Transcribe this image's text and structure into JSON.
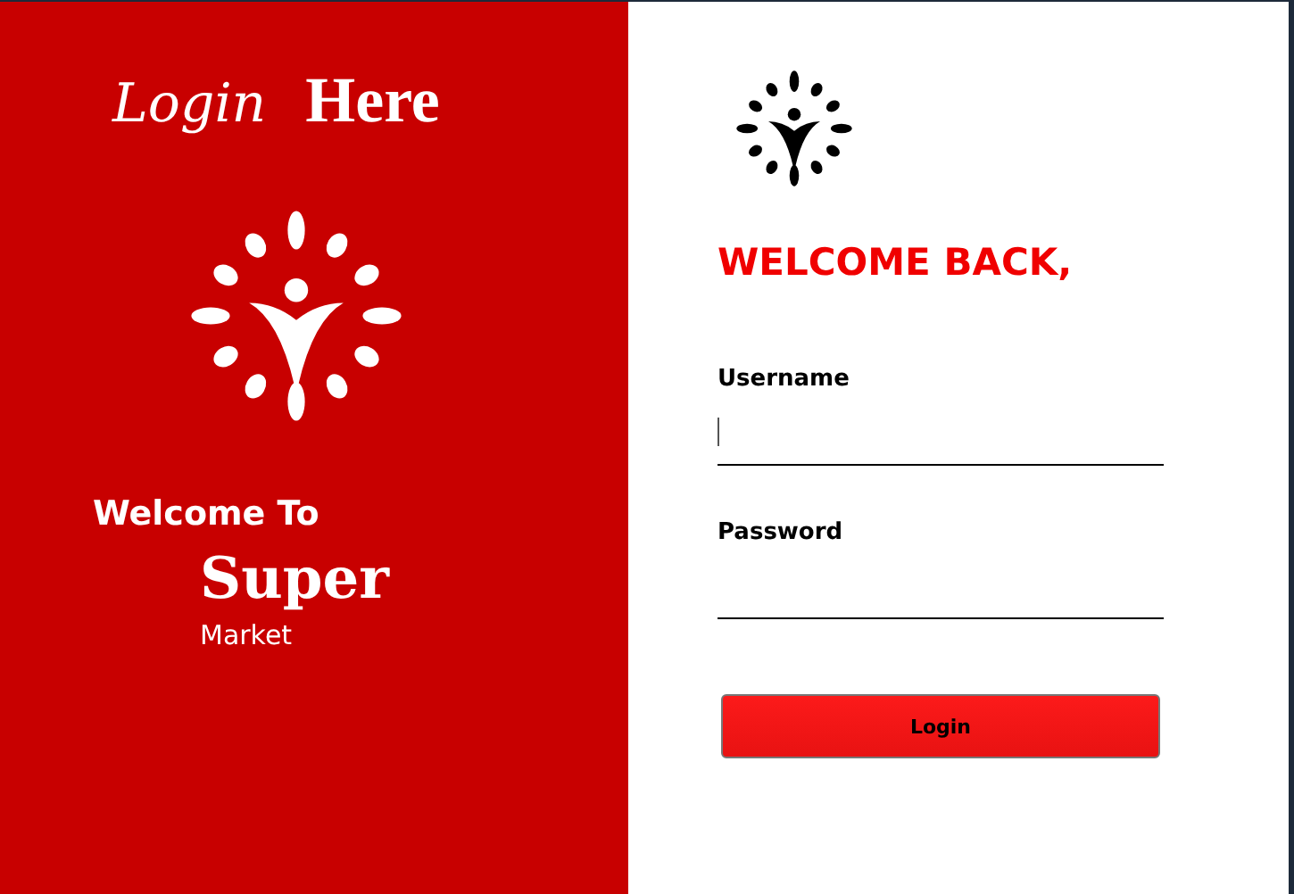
{
  "left_panel": {
    "heading": {
      "script_word": "Login",
      "bold_word": "Here"
    },
    "welcome": "Welcome To",
    "brand": "Super",
    "tagline": "Market"
  },
  "right_panel": {
    "heading": "WELCOME BACK,",
    "fields": [
      {
        "label": "Username",
        "focused": true
      },
      {
        "label": "Password",
        "focused": false
      }
    ],
    "button": "Login"
  }
}
